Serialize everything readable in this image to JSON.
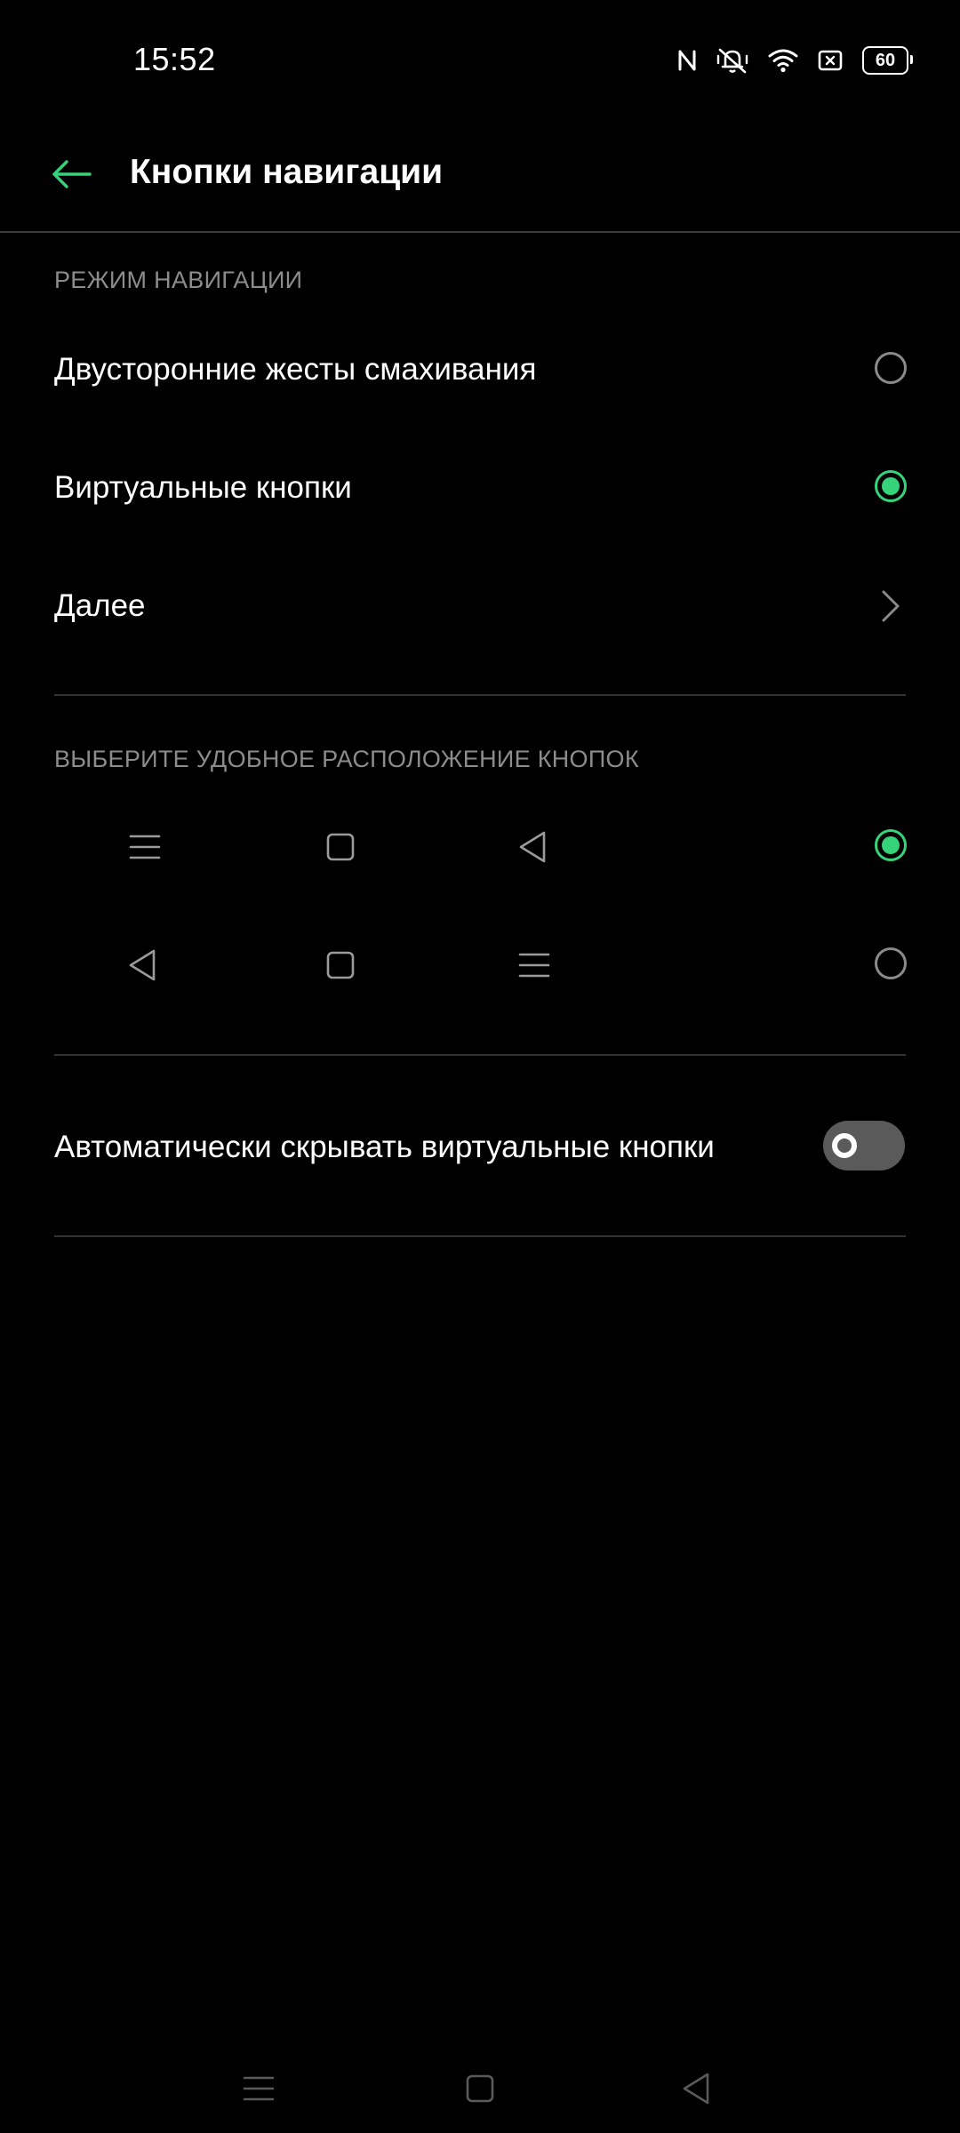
{
  "status_bar": {
    "time": "15:52",
    "battery_level": "60",
    "icons": [
      "nfc-icon",
      "mute-icon",
      "wifi-icon",
      "sim-icon",
      "battery-icon"
    ]
  },
  "header": {
    "title": "Кнопки навигации"
  },
  "navigation_mode": {
    "section_label": "РЕЖИМ НАВИГАЦИИ",
    "options": [
      {
        "label": "Двусторонние жесты смахивания",
        "selected": false
      },
      {
        "label": "Виртуальные кнопки",
        "selected": true
      }
    ],
    "more_label": "Далее"
  },
  "button_layout": {
    "section_label": "ВЫБЕРИТЕ УДОБНОЕ РАСПОЛОЖЕНИЕ КНОПОК",
    "options": [
      {
        "order": [
          "menu-icon",
          "home-square-icon",
          "back-triangle-icon"
        ],
        "selected": true
      },
      {
        "order": [
          "back-triangle-icon",
          "home-square-icon",
          "menu-icon"
        ],
        "selected": false
      }
    ]
  },
  "auto_hide": {
    "label": "Автоматически скрывать виртуальные кнопки",
    "enabled": false
  },
  "colors": {
    "accent": "#35d37a",
    "background": "#000000",
    "secondary_text": "#8c8c8c"
  }
}
